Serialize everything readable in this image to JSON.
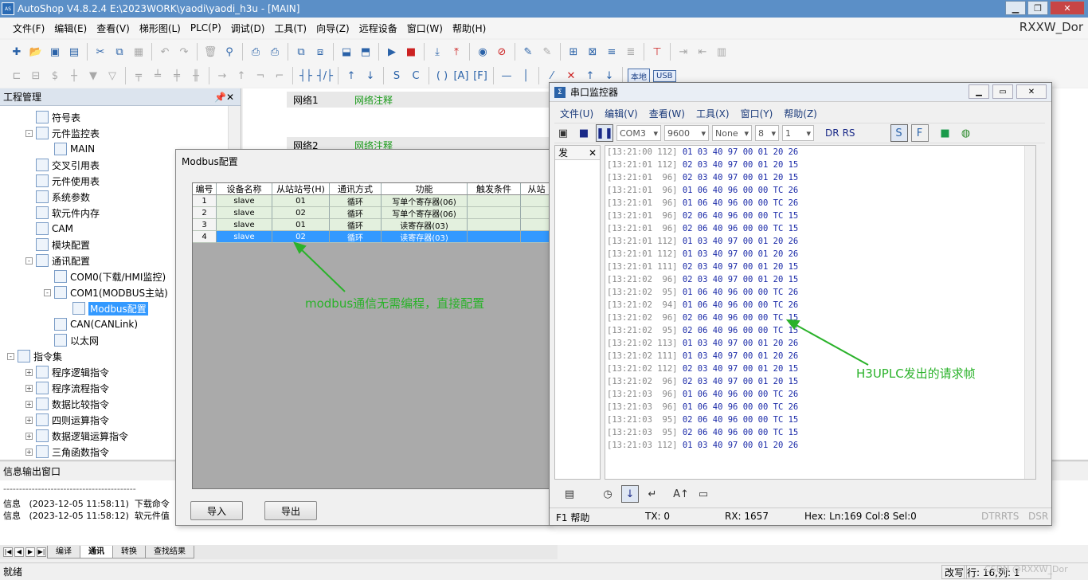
{
  "window": {
    "title": "AutoShop V4.8.2.4  E:\\2023WORK\\yaodi\\yaodi_h3u - [MAIN]",
    "user": "RXXW_Dor"
  },
  "menu": [
    "文件(F)",
    "编辑(E)",
    "查看(V)",
    "梯形图(L)",
    "PLC(P)",
    "调试(D)",
    "工具(T)",
    "向导(Z)",
    "远程设备",
    "窗口(W)",
    "帮助(H)"
  ],
  "toolbar": {
    "local_label": "本地",
    "usb_label": "USB"
  },
  "project_panel": {
    "title": "工程管理",
    "items": [
      {
        "label": "符号表",
        "indent": 2,
        "icon": "symbol-table-icon"
      },
      {
        "label": "元件监控表",
        "indent": 2,
        "icon": "monitor-table-icon",
        "exp": "-"
      },
      {
        "label": "MAIN",
        "indent": 3,
        "icon": "table-icon"
      },
      {
        "label": "交叉引用表",
        "indent": 2,
        "icon": "cross-ref-icon"
      },
      {
        "label": "元件使用表",
        "indent": 2,
        "icon": "usage-table-icon"
      },
      {
        "label": "系统参数",
        "indent": 2,
        "icon": "system-param-icon"
      },
      {
        "label": "软元件内存",
        "indent": 2,
        "icon": "memory-icon"
      },
      {
        "label": "CAM",
        "indent": 2,
        "icon": "cam-icon"
      },
      {
        "label": "模块配置",
        "indent": 2,
        "icon": "module-config-icon"
      },
      {
        "label": "通讯配置",
        "indent": 2,
        "icon": "comm-config-icon",
        "exp": "-"
      },
      {
        "label": "COM0(下载/HMI监控)",
        "indent": 3,
        "icon": "serial-port-icon"
      },
      {
        "label": "COM1(MODBUS主站)",
        "indent": 3,
        "icon": "serial-port-icon",
        "exp": "-"
      },
      {
        "label": "Modbus配置",
        "indent": 4,
        "icon": "modbus-config-icon",
        "selected": true
      },
      {
        "label": "CAN(CANLink)",
        "indent": 3,
        "icon": "can-network-icon"
      },
      {
        "label": "以太网",
        "indent": 3,
        "icon": "ethernet-icon"
      },
      {
        "label": "指令集",
        "indent": 1,
        "icon": "instruction-set-icon",
        "exp": "-"
      },
      {
        "label": "程序逻辑指令",
        "indent": 2,
        "icon": "instruction-icon",
        "exp": "+"
      },
      {
        "label": "程序流程指令",
        "indent": 2,
        "icon": "instruction-icon",
        "exp": "+"
      },
      {
        "label": "数据比较指令",
        "indent": 2,
        "icon": "instruction-icon",
        "exp": "+"
      },
      {
        "label": "四则运算指令",
        "indent": 2,
        "icon": "instruction-icon",
        "exp": "+"
      },
      {
        "label": "数据逻辑运算指令",
        "indent": 2,
        "icon": "instruction-icon",
        "exp": "+"
      },
      {
        "label": "三角函数指令",
        "indent": 2,
        "icon": "instruction-icon",
        "exp": "+"
      }
    ]
  },
  "ladder": {
    "rows": [
      {
        "network": "网络1",
        "comment": "网络注释"
      },
      {
        "network": "网络2",
        "comment": "网络注释"
      }
    ]
  },
  "modbus_dialog": {
    "title": "Modbus配置",
    "columns": [
      "编号",
      "设备名称",
      "从站站号(H)",
      "通讯方式",
      "功能",
      "触发条件",
      "从站"
    ],
    "rows": [
      [
        "1",
        "slave",
        "01",
        "循环",
        "写单个寄存器(06)",
        ""
      ],
      [
        "2",
        "slave",
        "02",
        "循环",
        "写单个寄存器(06)",
        ""
      ],
      [
        "3",
        "slave",
        "01",
        "循环",
        "读寄存器(03)",
        ""
      ],
      [
        "4",
        "slave",
        "02",
        "循环",
        "读寄存器(03)",
        ""
      ]
    ],
    "import_label": "导入",
    "export_label": "导出"
  },
  "serial_monitor": {
    "title": "串口监控器",
    "menu": [
      "文件(U)",
      "编辑(V)",
      "查看(W)",
      "工具(X)",
      "窗口(Y)",
      "帮助(Z)"
    ],
    "port": "COM3",
    "baud": "9600",
    "parity": "None",
    "databits": "8",
    "stopbits": "1",
    "dr_label": "DR",
    "rs_label": "RS",
    "send_tab": "发",
    "log": [
      {
        "time": "[13:21:00 112]",
        "data": "01 03 40 97 00 01 20 26"
      },
      {
        "time": "[13:21:01 112]",
        "data": "02 03 40 97 00 01 20 15"
      },
      {
        "time": "[13:21:01  96]",
        "data": "02 03 40 97 00 01 20 15"
      },
      {
        "time": "[13:21:01  96]",
        "data": "01 06 40 96 00 00 TC 26"
      },
      {
        "time": "[13:21:01  96]",
        "data": "01 06 40 96 00 00 TC 26"
      },
      {
        "time": "[13:21:01  96]",
        "data": "02 06 40 96 00 00 TC 15"
      },
      {
        "time": "[13:21:01  96]",
        "data": "02 06 40 96 00 00 TC 15"
      },
      {
        "time": "[13:21:01 112]",
        "data": "01 03 40 97 00 01 20 26"
      },
      {
        "time": "[13:21:01 112]",
        "data": "01 03 40 97 00 01 20 26"
      },
      {
        "time": "[13:21:01 111]",
        "data": "02 03 40 97 00 01 20 15"
      },
      {
        "time": "[13:21:02  96]",
        "data": "02 03 40 97 00 01 20 15"
      },
      {
        "time": "[13:21:02  95]",
        "data": "01 06 40 96 00 00 TC 26"
      },
      {
        "time": "[13:21:02  94]",
        "data": "01 06 40 96 00 00 TC 26"
      },
      {
        "time": "[13:21:02  96]",
        "data": "02 06 40 96 00 00 TC 15"
      },
      {
        "time": "[13:21:02  95]",
        "data": "02 06 40 96 00 00 TC 15"
      },
      {
        "time": "[13:21:02 113]",
        "data": "01 03 40 97 00 01 20 26"
      },
      {
        "time": "[13:21:02 111]",
        "data": "01 03 40 97 00 01 20 26"
      },
      {
        "time": "[13:21:02 112]",
        "data": "02 03 40 97 00 01 20 15"
      },
      {
        "time": "[13:21:02  96]",
        "data": "02 03 40 97 00 01 20 15"
      },
      {
        "time": "[13:21:03  96]",
        "data": "01 06 40 96 00 00 TC 26"
      },
      {
        "time": "[13:21:03  96]",
        "data": "01 06 40 96 00 00 TC 26"
      },
      {
        "time": "[13:21:03  95]",
        "data": "02 06 40 96 00 00 TC 15"
      },
      {
        "time": "[13:21:03  95]",
        "data": "02 06 40 96 00 00 TC 15"
      },
      {
        "time": "[13:21:03 112]",
        "data": "01 03 40 97 00 01 20 26"
      }
    ],
    "status": {
      "help": "F1 帮助",
      "tx": "TX: 0",
      "rx": "RX: 1657",
      "hex": "Hex: Ln:169  Col:8  Sel:0",
      "dtr": "DTRRTS",
      "dsr": "DSR"
    }
  },
  "info_panel": {
    "title": "信息输出窗口",
    "separator": "------------------------------------------",
    "lines": [
      {
        "type": "信息",
        "time": "(2023-12-05 11:58:11)",
        "msg": "下载命令"
      },
      {
        "type": "信息",
        "time": "(2023-12-05 11:58:12)",
        "msg": "软元件值"
      }
    ]
  },
  "bottom_tabs": [
    "编译",
    "通讯",
    "转换",
    "查找结果"
  ],
  "status": {
    "ready": "就绪",
    "mode": "改写",
    "pos": "行:  16,列:   1"
  },
  "annotations": {
    "modbus": "modbus通信无需编程，直接配置",
    "h3u": "H3UPLC发出的请求帧"
  },
  "watermark": "CSDN @RXXW_Dor"
}
